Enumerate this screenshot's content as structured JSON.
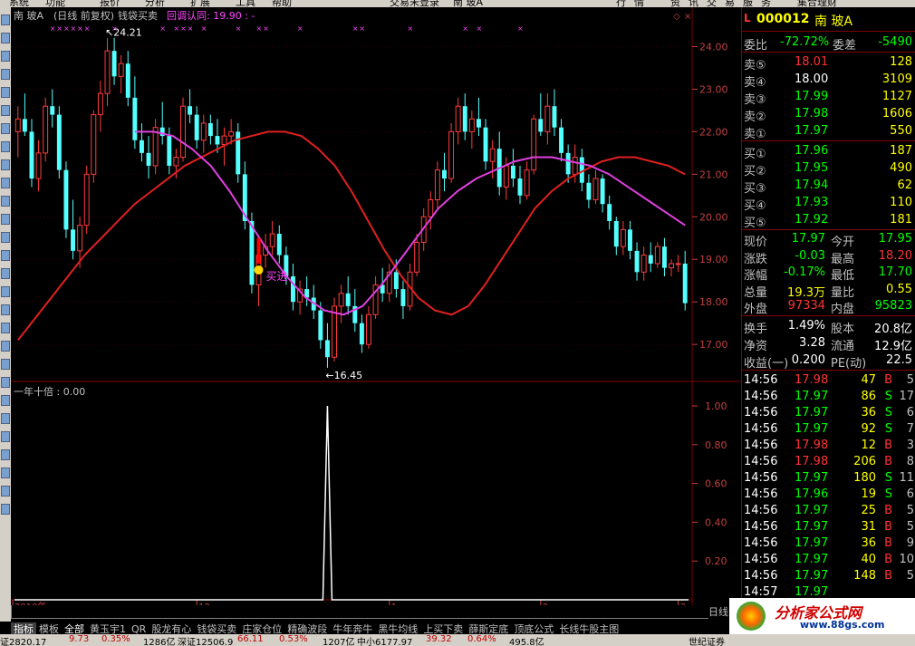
{
  "menu": [
    "系统",
    "功能",
    "报价",
    "分析",
    "扩展",
    "工具",
    "帮助",
    "交易未登录",
    "南  玻A",
    "行",
    "情",
    "资",
    "讯",
    "交",
    "易",
    "服",
    "务",
    "集合理财"
  ],
  "chart_header": {
    "stock": "南  玻A",
    "period": "(日线 前复权)",
    "indicator": "钱袋买卖",
    "confirm_label": "回调认同: 19.90 : -"
  },
  "price_axis": [
    "24.00",
    "23.00",
    "22.00",
    "21.00",
    "20.00",
    "19.00",
    "18.00",
    "17.00"
  ],
  "annotations": {
    "high": "24.21",
    "low": "16.45",
    "buy_signal": "买进"
  },
  "sub_chart": {
    "title": "一年十倍 : 0.00",
    "axis": [
      "1.00",
      "0.80",
      "0.60",
      "0.40",
      "0.20"
    ]
  },
  "time_axis": [
    "2010年",
    "12",
    "1",
    "2",
    "3",
    "4"
  ],
  "chart_data": {
    "type": "candlestick",
    "y_range": [
      16.3,
      24.5
    ],
    "candles": [
      [
        22.0,
        22.6,
        21.4,
        22.3
      ],
      [
        22.3,
        22.9,
        21.9,
        22.0
      ],
      [
        22.0,
        22.3,
        20.7,
        20.9
      ],
      [
        20.9,
        21.8,
        20.6,
        21.5
      ],
      [
        21.5,
        22.8,
        21.3,
        22.6
      ],
      [
        22.6,
        23.0,
        22.1,
        22.4
      ],
      [
        22.4,
        22.6,
        20.9,
        21.1
      ],
      [
        21.1,
        21.3,
        19.5,
        19.7
      ],
      [
        19.7,
        20.4,
        19.0,
        19.2
      ],
      [
        19.2,
        20.0,
        18.8,
        19.8
      ],
      [
        19.8,
        21.2,
        19.6,
        21.0
      ],
      [
        21.0,
        22.5,
        20.8,
        22.4
      ],
      [
        22.4,
        23.2,
        22.0,
        22.9
      ],
      [
        22.9,
        24.2,
        22.6,
        23.9
      ],
      [
        23.9,
        24.21,
        23.1,
        23.3
      ],
      [
        23.3,
        23.8,
        22.9,
        23.6
      ],
      [
        23.6,
        23.9,
        22.6,
        22.8
      ],
      [
        22.8,
        23.3,
        21.6,
        21.8
      ],
      [
        21.8,
        22.2,
        21.3,
        21.5
      ],
      [
        21.5,
        21.9,
        20.9,
        21.2
      ],
      [
        21.2,
        22.3,
        21.0,
        22.1
      ],
      [
        22.1,
        22.7,
        21.7,
        21.9
      ],
      [
        21.9,
        22.1,
        21.0,
        21.2
      ],
      [
        21.2,
        21.6,
        20.9,
        21.4
      ],
      [
        21.4,
        22.8,
        21.3,
        22.6
      ],
      [
        22.6,
        23.0,
        22.2,
        22.4
      ],
      [
        22.4,
        22.6,
        21.6,
        21.8
      ],
      [
        21.8,
        22.4,
        21.5,
        22.2
      ],
      [
        22.2,
        22.4,
        21.7,
        21.9
      ],
      [
        21.9,
        22.3,
        21.5,
        21.7
      ],
      [
        21.7,
        22.1,
        21.2,
        21.9
      ],
      [
        21.9,
        22.3,
        21.7,
        22.0
      ],
      [
        22.0,
        22.2,
        20.8,
        21.0
      ],
      [
        21.0,
        21.3,
        19.7,
        19.9
      ],
      [
        19.9,
        20.1,
        18.2,
        18.4
      ],
      [
        18.4,
        19.3,
        17.9,
        19.1
      ],
      [
        19.1,
        19.6,
        18.8,
        19.3
      ],
      [
        19.3,
        19.9,
        19.1,
        19.6
      ],
      [
        19.6,
        19.8,
        18.9,
        19.1
      ],
      [
        19.1,
        19.3,
        18.4,
        18.6
      ],
      [
        18.6,
        18.9,
        17.8,
        18.0
      ],
      [
        18.0,
        18.5,
        17.7,
        18.3
      ],
      [
        18.3,
        18.6,
        17.9,
        18.1
      ],
      [
        18.1,
        18.4,
        17.6,
        17.8
      ],
      [
        17.8,
        18.0,
        16.9,
        17.1
      ],
      [
        17.1,
        17.5,
        16.45,
        16.7
      ],
      [
        16.7,
        18.1,
        16.6,
        17.9
      ],
      [
        17.9,
        18.4,
        17.5,
        18.2
      ],
      [
        18.2,
        18.6,
        17.7,
        17.9
      ],
      [
        17.9,
        18.3,
        17.3,
        17.5
      ],
      [
        17.5,
        17.7,
        16.8,
        17.0
      ],
      [
        17.0,
        17.9,
        16.9,
        17.7
      ],
      [
        17.7,
        18.6,
        17.6,
        18.4
      ],
      [
        18.4,
        18.8,
        18.0,
        18.2
      ],
      [
        18.2,
        18.9,
        18.0,
        18.7
      ],
      [
        18.7,
        19.0,
        18.1,
        18.3
      ],
      [
        18.3,
        18.5,
        17.6,
        17.9
      ],
      [
        17.9,
        18.9,
        17.8,
        18.7
      ],
      [
        18.7,
        19.6,
        18.6,
        19.4
      ],
      [
        19.4,
        20.2,
        19.2,
        20.0
      ],
      [
        20.0,
        20.6,
        19.7,
        20.4
      ],
      [
        20.4,
        21.3,
        20.2,
        21.1
      ],
      [
        21.1,
        21.5,
        20.6,
        20.9
      ],
      [
        20.9,
        22.2,
        20.8,
        22.0
      ],
      [
        22.0,
        22.8,
        21.7,
        22.6
      ],
      [
        22.6,
        22.9,
        21.8,
        22.0
      ],
      [
        22.0,
        22.5,
        21.6,
        22.3
      ],
      [
        22.3,
        22.8,
        21.9,
        22.1
      ],
      [
        22.1,
        22.3,
        21.1,
        21.3
      ],
      [
        21.3,
        21.8,
        20.9,
        21.6
      ],
      [
        21.6,
        22.0,
        20.5,
        20.7
      ],
      [
        20.7,
        21.4,
        20.4,
        21.2
      ],
      [
        21.2,
        21.6,
        20.7,
        20.9
      ],
      [
        20.9,
        21.2,
        20.3,
        20.5
      ],
      [
        20.5,
        21.3,
        20.4,
        21.1
      ],
      [
        21.1,
        22.4,
        21.0,
        22.3
      ],
      [
        22.3,
        22.9,
        21.9,
        22.0
      ],
      [
        22.0,
        22.9,
        21.7,
        22.6
      ],
      [
        22.6,
        23.0,
        21.9,
        22.1
      ],
      [
        22.1,
        22.3,
        21.3,
        21.5
      ],
      [
        21.5,
        21.7,
        20.8,
        21.0
      ],
      [
        21.0,
        21.7,
        20.8,
        21.4
      ],
      [
        21.4,
        21.6,
        20.6,
        20.8
      ],
      [
        20.8,
        21.0,
        20.2,
        20.4
      ],
      [
        20.4,
        21.1,
        20.3,
        20.9
      ],
      [
        20.9,
        21.0,
        20.1,
        20.3
      ],
      [
        20.3,
        20.5,
        19.7,
        19.9
      ],
      [
        19.9,
        20.0,
        19.1,
        19.3
      ],
      [
        19.3,
        19.9,
        19.1,
        19.7
      ],
      [
        19.7,
        19.9,
        19.0,
        19.2
      ],
      [
        19.2,
        19.4,
        18.5,
        18.7
      ],
      [
        18.7,
        19.3,
        18.5,
        19.1
      ],
      [
        19.1,
        19.4,
        18.7,
        18.9
      ],
      [
        18.9,
        19.4,
        18.8,
        19.3
      ],
      [
        19.3,
        19.5,
        18.6,
        18.8
      ],
      [
        18.8,
        19.0,
        18.6,
        18.9
      ],
      [
        18.9,
        19.1,
        18.7,
        18.9
      ],
      [
        18.9,
        19.2,
        17.8,
        17.97
      ]
    ],
    "ma_red": [
      17.1,
      17.6,
      18.1,
      18.6,
      19.1,
      19.5,
      19.9,
      20.3,
      20.6,
      20.9,
      21.2,
      21.4,
      21.6,
      21.8,
      21.9,
      22.0,
      22.0,
      21.9,
      21.6,
      21.2,
      20.6,
      19.9,
      19.2,
      18.6,
      18.1,
      17.8,
      17.7,
      17.9,
      18.4,
      19.0,
      19.6,
      20.2,
      20.6,
      20.9,
      21.1,
      21.3,
      21.4,
      21.4,
      21.3,
      21.2,
      21.0
    ],
    "ma_purple_start": 17,
    "ma_purple": [
      22.0,
      22.0,
      21.9,
      21.6,
      21.2,
      20.6,
      19.9,
      19.2,
      18.6,
      18.1,
      17.8,
      17.7,
      17.9,
      18.4,
      19.0,
      19.6,
      20.2,
      20.6,
      20.9,
      21.1,
      21.3,
      21.4,
      21.4,
      21.3,
      21.2,
      21.0,
      20.7,
      20.4,
      20.1,
      19.8
    ],
    "spike_index": 45,
    "signal_range": [
      0,
      1
    ]
  },
  "quote_panel": {
    "code": "000012",
    "name": "南  玻A",
    "weibi_label": "委比",
    "weibi": "-72.72%",
    "weicha_label": "委差",
    "weicha": "-5490",
    "asks": [
      {
        "label": "卖⑤",
        "price": "18.01",
        "vol": "128"
      },
      {
        "label": "卖④",
        "price": "18.00",
        "vol": "3109"
      },
      {
        "label": "卖③",
        "price": "17.99",
        "vol": "1127"
      },
      {
        "label": "卖②",
        "price": "17.98",
        "vol": "1606"
      },
      {
        "label": "卖①",
        "price": "17.97",
        "vol": "550"
      }
    ],
    "bids": [
      {
        "label": "买①",
        "price": "17.96",
        "vol": "187"
      },
      {
        "label": "买②",
        "price": "17.95",
        "vol": "490"
      },
      {
        "label": "买③",
        "price": "17.94",
        "vol": "62"
      },
      {
        "label": "买④",
        "price": "17.93",
        "vol": "110"
      },
      {
        "label": "买⑤",
        "price": "17.92",
        "vol": "181"
      }
    ],
    "stats": [
      {
        "l1": "现价",
        "v1": "17.97",
        "l2": "今开",
        "v2": "17.95",
        "c1": "#00ff00",
        "c2": "#00ff00"
      },
      {
        "l1": "涨跌",
        "v1": "-0.03",
        "l2": "最高",
        "v2": "18.20",
        "c1": "#00ff00",
        "c2": "#ff3333"
      },
      {
        "l1": "涨幅",
        "v1": "-0.17%",
        "l2": "最低",
        "v2": "17.70",
        "c1": "#00ff00",
        "c2": "#00ff00"
      },
      {
        "l1": "总量",
        "v1": "19.3万",
        "l2": "量比",
        "v2": "0.55",
        "c1": "#ffff00",
        "c2": "#ffff00"
      },
      {
        "l1": "外盘",
        "v1": "97334",
        "l2": "内盘",
        "v2": "95823",
        "c1": "#ff3333",
        "c2": "#00ff00"
      }
    ],
    "stats2": [
      {
        "l1": "换手",
        "v1": "1.49%",
        "l2": "股本",
        "v2": "20.8亿"
      },
      {
        "l1": "净资",
        "v1": "3.28",
        "l2": "流通",
        "v2": "12.9亿"
      },
      {
        "l1": "收益(一)",
        "v1": "0.200",
        "l2": "PE(动)",
        "v2": "22.5"
      }
    ],
    "ticks": [
      {
        "t": "14:56",
        "p": "17.98",
        "v": "47",
        "d": "B",
        "n": "5"
      },
      {
        "t": "14:56",
        "p": "17.97",
        "v": "86",
        "d": "S",
        "n": "17"
      },
      {
        "t": "14:56",
        "p": "17.97",
        "v": "36",
        "d": "S",
        "n": "6"
      },
      {
        "t": "14:56",
        "p": "17.97",
        "v": "92",
        "d": "S",
        "n": "7"
      },
      {
        "t": "14:56",
        "p": "17.98",
        "v": "12",
        "d": "B",
        "n": "3"
      },
      {
        "t": "14:56",
        "p": "17.98",
        "v": "206",
        "d": "B",
        "n": "8"
      },
      {
        "t": "14:56",
        "p": "17.97",
        "v": "180",
        "d": "S",
        "n": "11"
      },
      {
        "t": "14:56",
        "p": "17.96",
        "v": "19",
        "d": "S",
        "n": "6"
      },
      {
        "t": "14:56",
        "p": "17.97",
        "v": "25",
        "d": "B",
        "n": "5"
      },
      {
        "t": "14:56",
        "p": "17.97",
        "v": "31",
        "d": "B",
        "n": "5"
      },
      {
        "t": "14:56",
        "p": "17.97",
        "v": "36",
        "d": "B",
        "n": "9"
      },
      {
        "t": "14:56",
        "p": "17.97",
        "v": "40",
        "d": "B",
        "n": "10"
      },
      {
        "t": "14:56",
        "p": "17.97",
        "v": "148",
        "d": "B",
        "n": "5"
      },
      {
        "t": "14:57",
        "p": "17.97",
        "v": "",
        "d": "",
        "n": ""
      }
    ]
  },
  "day_button": "日线",
  "tabs": [
    "指标",
    "模板",
    "全部",
    "黄玉宇1",
    "QR",
    "股龙有心",
    "钱袋买卖",
    "庄家仓位",
    "精确波段",
    "牛年奔牛",
    "黑牛均线",
    "上买下卖",
    "薛斯定底",
    "顶底公式",
    "长线牛股主图"
  ],
  "status": [
    "证2820.17",
    "9.73",
    "0.35%",
    "1286亿",
    "深证12506.9",
    "66.11",
    "0.53%",
    "1207亿",
    "中小6177.97",
    "39.32",
    "0.64%",
    "495.8亿",
    "世纪证券"
  ],
  "logo": {
    "title": "分析家公式网",
    "url": "www.88gs.com"
  }
}
